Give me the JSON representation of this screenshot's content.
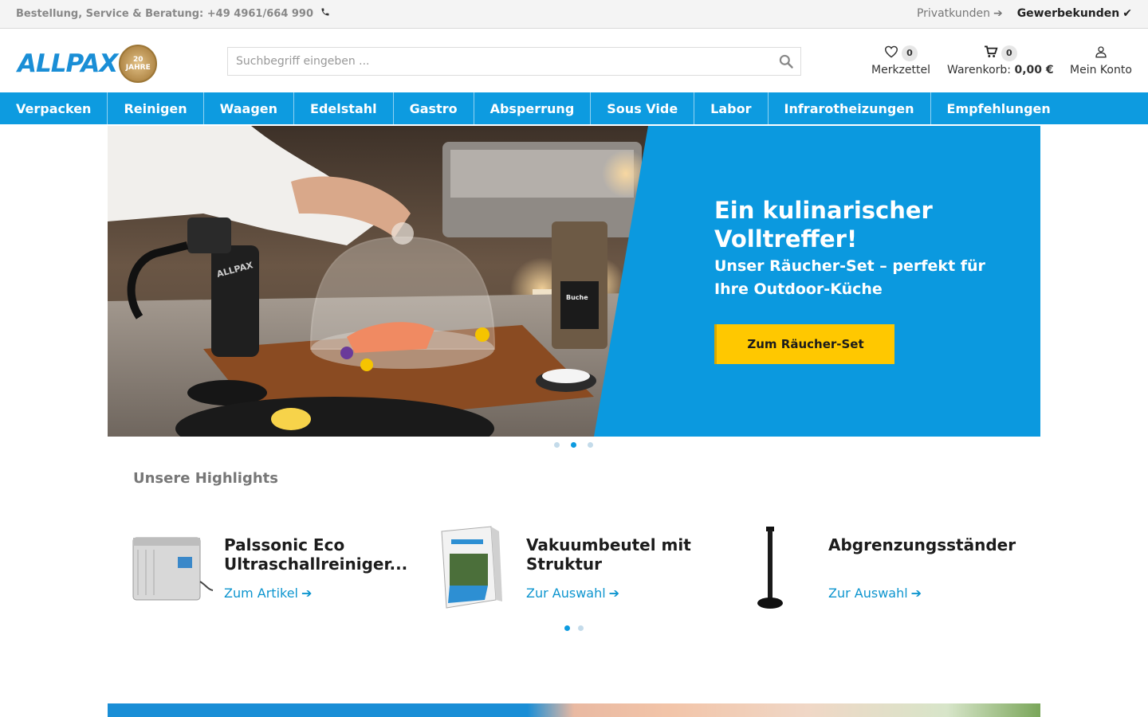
{
  "topbar": {
    "service_text": "Bestellung, Service & Beratung: +49 4961/664 990",
    "phone_icon": "phone-icon",
    "private_label": "Privatkunden",
    "business_label": "Gewerbekunden"
  },
  "header": {
    "logo_text": "ALLPAX",
    "badge_line1": "20",
    "badge_line2": "JAHRE",
    "search_placeholder": "Suchbegriff eingeben ...",
    "wishlist": {
      "count": "0",
      "label": "Merkzettel"
    },
    "cart": {
      "count": "0",
      "label": "Warenkorb:",
      "amount": "0,00 €"
    },
    "account": {
      "label": "Mein Konto"
    }
  },
  "nav": {
    "items": [
      "Verpacken",
      "Reinigen",
      "Waagen",
      "Edelstahl",
      "Gastro",
      "Absperrung",
      "Sous Vide",
      "Labor",
      "Infrarotheizungen",
      "Empfehlungen"
    ]
  },
  "hero": {
    "headline": "Ein kulinarischer Volltreffer!",
    "subline": "Unser Räucher-Set – perfekt für Ihre Outdoor-Küche",
    "cta": "Zum Räucher-Set",
    "smoker_brand": "ALLPAX",
    "bag_text": "Buche",
    "active_slide": 2,
    "slide_count": 3
  },
  "highlights": {
    "title": "Unsere Highlights",
    "items": [
      {
        "name": "Palssonic Eco Ultraschallreiniger...",
        "link": "Zum Artikel"
      },
      {
        "name": "Vakuumbeutel mit Struktur",
        "link": "Zur Auswahl"
      },
      {
        "name": "Abgrenzungsständer",
        "link": "Zur Auswahl"
      }
    ],
    "active_page": 1,
    "page_count": 2
  },
  "colors": {
    "brand_blue": "#0d9be0",
    "cta_yellow": "#ffc800",
    "link_blue": "#0d95cf"
  }
}
